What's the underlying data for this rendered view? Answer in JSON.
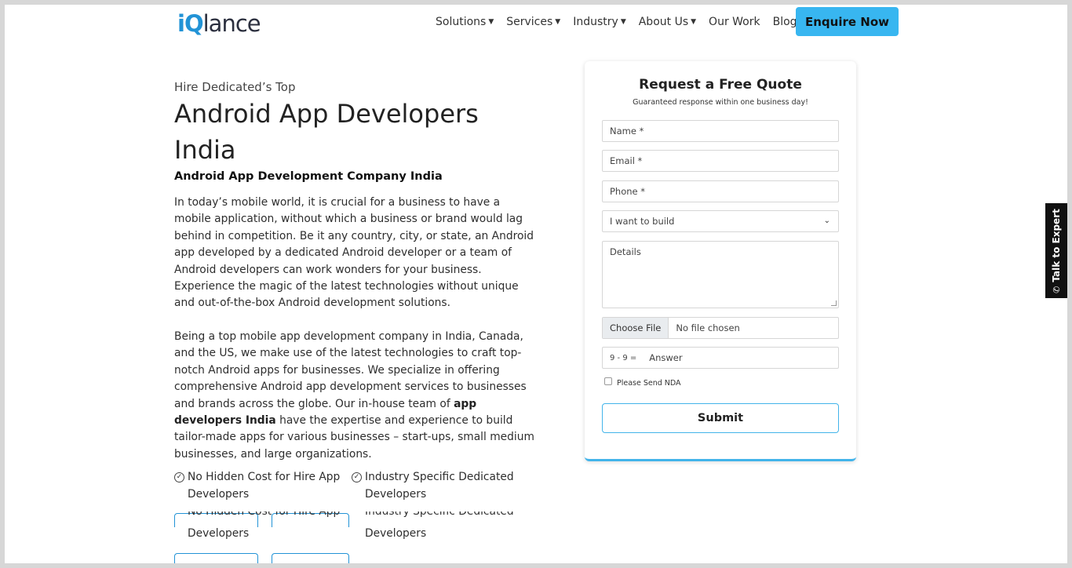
{
  "header": {
    "logo": {
      "i": "i",
      "q": "Q",
      "rest": "lance"
    },
    "nav": [
      {
        "label": "Solutions",
        "dropdown": true
      },
      {
        "label": "Services",
        "dropdown": true
      },
      {
        "label": "Industry",
        "dropdown": true
      },
      {
        "label": "About Us",
        "dropdown": true
      },
      {
        "label": "Our Work",
        "dropdown": false
      },
      {
        "label": "Blog",
        "dropdown": false
      }
    ],
    "cta": "Enquire Now"
  },
  "hero": {
    "eyebrow": "Hire Dedicated’s Top",
    "title": "Android App Developers India",
    "subheading": "Android App Development Company India",
    "para1": "In today’s mobile world, it is crucial for a business to have a mobile application, without which a business or brand would lag behind in competition. Be it any country, city, or state, an Android app developed by a dedicated Android developer or a team of Android developers can work wonders for your business. Experience the magic of the latest technologies without unique and out-of-the-box Android development solutions.",
    "para2_a": "Being a top mobile app development company in India, Canada, and the US, we make use of the latest technologies to craft top-notch Android apps for businesses. We specialize in offering comprehensive Android app development services to businesses and brands across the globe. Our in-house team of ",
    "para2_bold": "app developers India",
    "para2_b": " have the expertise and experience to build tailor-made apps for various businesses – start-ups, small medium businesses, and large organizations.",
    "checks": [
      "No Hidden Cost for Hire App Developers",
      "Industry Specific Dedicated Developers"
    ],
    "checks_dup": [
      "Developers",
      "Developers"
    ],
    "ghost_left": "No Hidden Cost for Hire App",
    "ghost_right": "Industry Specific Dedicated"
  },
  "form": {
    "title": "Request a Free Quote",
    "subtitle": "Guaranteed response within one business day!",
    "name_placeholder": "Name *",
    "email_placeholder": "Email *",
    "phone_placeholder": "Phone *",
    "build_select": "I want to build",
    "details_placeholder": "Details",
    "choose_file": "Choose File",
    "no_file": "No file chosen",
    "captcha_question": "9 - 9 =",
    "captcha_placeholder": "Answer",
    "nda_label": "Please Send NDA",
    "submit": "Submit"
  },
  "side_tab": {
    "label": "Talk to Expert"
  },
  "colors": {
    "accent": "#38b6f0",
    "brand_blue": "#2293d6",
    "tab_bg": "#111111"
  }
}
